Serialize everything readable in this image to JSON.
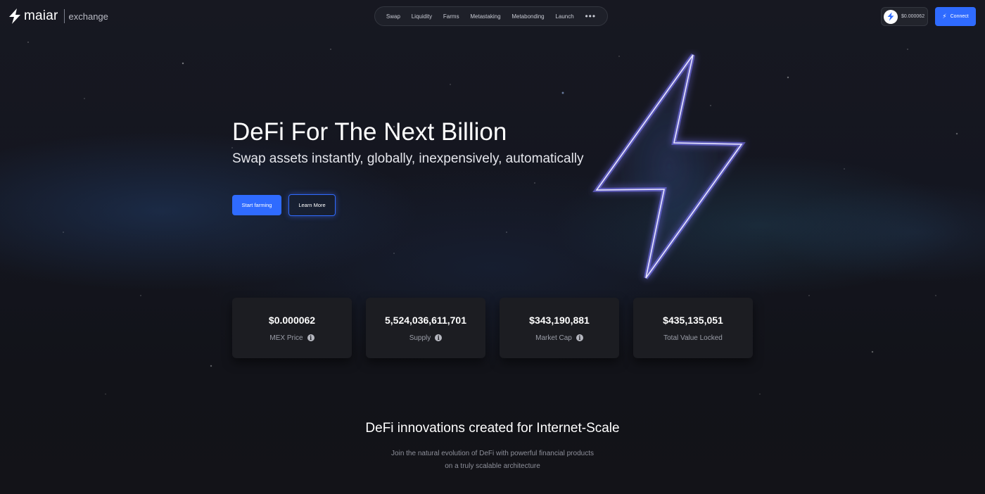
{
  "header": {
    "logo_text": "maiar",
    "logo_sub": "exchange",
    "nav": [
      {
        "label": "Swap"
      },
      {
        "label": "Liquidity"
      },
      {
        "label": "Farms"
      },
      {
        "label": "Metastaking"
      },
      {
        "label": "Metabonding"
      },
      {
        "label": "Launch"
      }
    ],
    "nav_more": "•••",
    "price": "$0.000062",
    "connect_label": "Connect"
  },
  "hero": {
    "title": "DeFi For The Next Billion",
    "subtitle": "Swap assets instantly, globally, inexpensively, automatically",
    "primary_button": "Start farming",
    "secondary_button": "Learn More"
  },
  "stats": [
    {
      "value": "$0.000062",
      "label": "MEX Price",
      "info": true
    },
    {
      "value": "5,524,036,611,701",
      "label": "Supply",
      "info": true
    },
    {
      "value": "$343,190,881",
      "label": "Market Cap",
      "info": true
    },
    {
      "value": "$435,135,051",
      "label": "Total Value Locked",
      "info": false
    }
  ],
  "section": {
    "title": "DeFi innovations created for Internet-Scale",
    "desc_line1": "Join the natural evolution of DeFi with powerful financial products",
    "desc_line2": "on a truly scalable architecture"
  },
  "colors": {
    "accent": "#2f6bff",
    "card_bg": "#1c1d22",
    "background": "#141620"
  }
}
